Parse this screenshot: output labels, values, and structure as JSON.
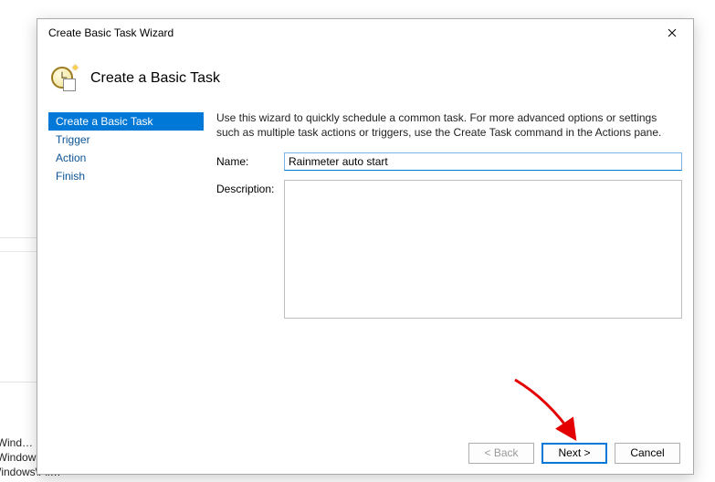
{
  "dialog": {
    "title": "Create Basic Task Wizard",
    "heading": "Create a Basic Task",
    "intro": "Use this wizard to quickly schedule a common task.  For more advanced options or settings such as multiple task actions or triggers, use the Create Task command in the Actions pane.",
    "name_label": "Name:",
    "name_value": "Rainmeter auto start",
    "desc_label": "Description:",
    "desc_value": ""
  },
  "steps": [
    "Create a Basic Task",
    "Trigger",
    "Action",
    "Finish"
  ],
  "buttons": {
    "back": "< Back",
    "next": "Next >",
    "cancel": "Cancel"
  },
  "background": {
    "line1": "oft\\Wind…",
    "line2": "oft\\Windows\\U…",
    "line3": "ft\\Windows\\Fli…"
  }
}
